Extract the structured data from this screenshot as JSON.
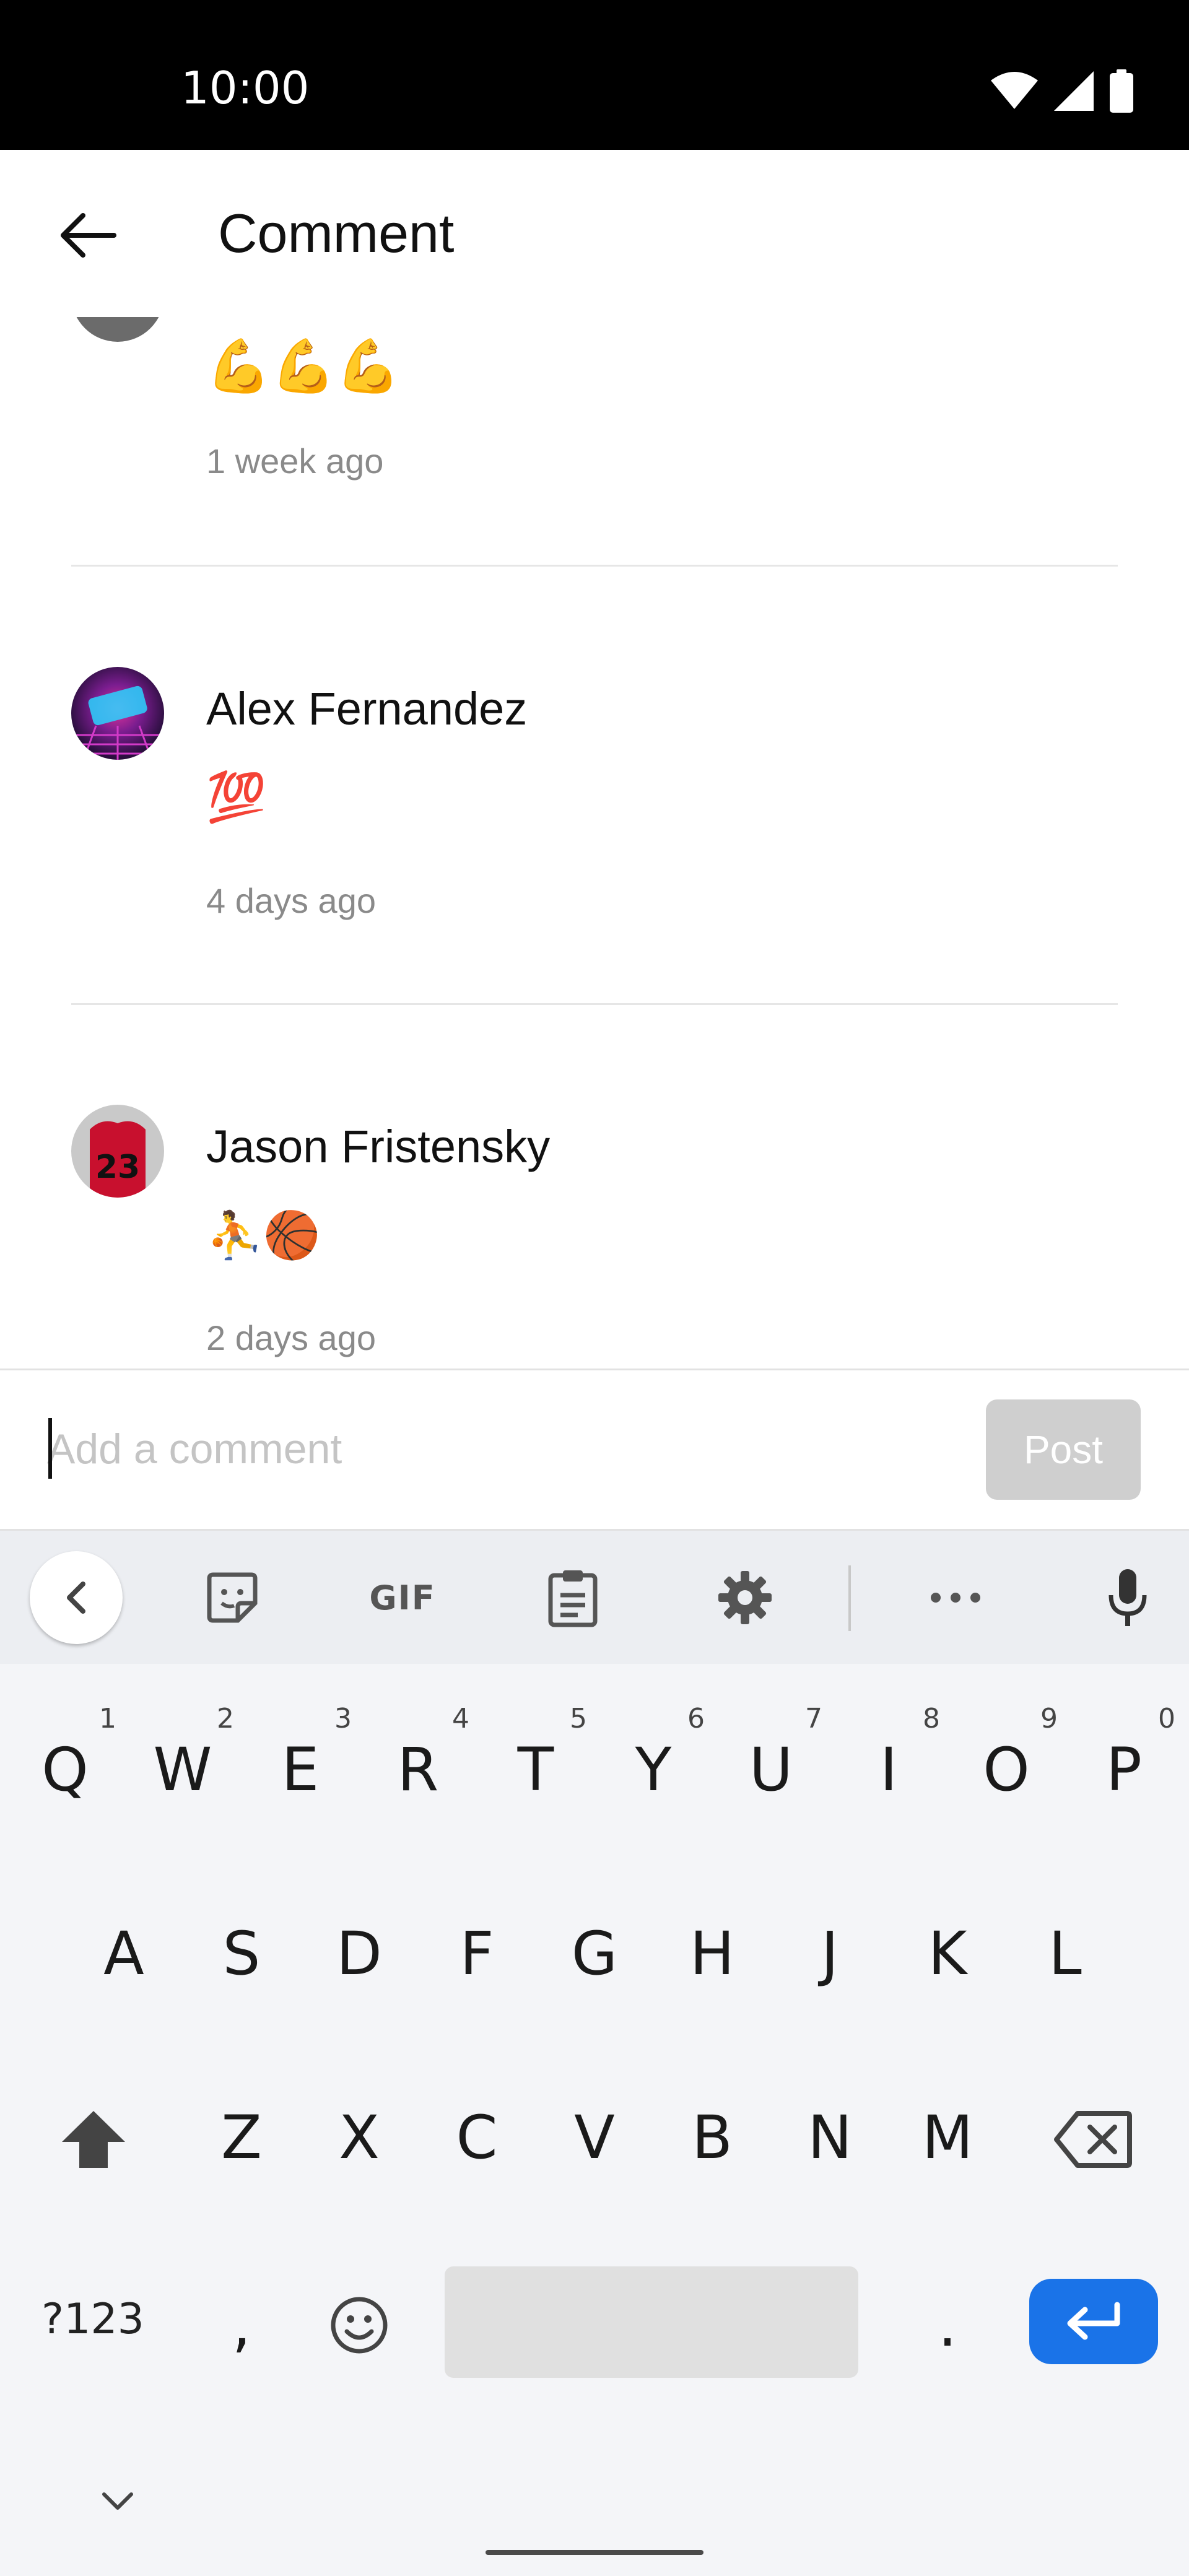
{
  "status_bar": {
    "time": "10:00",
    "icons": [
      "wifi-icon",
      "cellular-signal-icon",
      "battery-icon"
    ]
  },
  "app_bar": {
    "back_icon": "arrow-left-icon",
    "title": "Comment"
  },
  "comments": [
    {
      "name": "",
      "body": "💪💪💪",
      "time": "1 week ago"
    },
    {
      "name": "Alex Fernandez",
      "body": "💯",
      "time": "4 days ago"
    },
    {
      "name": "Jason Fristensky",
      "body": "⛹🏀",
      "time": "2 days ago"
    }
  ],
  "composer": {
    "placeholder": "Add a comment",
    "value": "",
    "post_label": "Post"
  },
  "keyboard": {
    "toolbar": {
      "gif_label": "GIF",
      "icons": [
        "chevron-left-icon",
        "sticker-icon",
        "gif-icon",
        "clipboard-icon",
        "settings-gear-icon",
        "more-icon",
        "microphone-icon"
      ]
    },
    "row1": {
      "keys": [
        "Q",
        "W",
        "E",
        "R",
        "T",
        "Y",
        "U",
        "I",
        "O",
        "P"
      ],
      "hints": [
        "1",
        "2",
        "3",
        "4",
        "5",
        "6",
        "7",
        "8",
        "9",
        "0"
      ]
    },
    "row2": {
      "keys": [
        "A",
        "S",
        "D",
        "F",
        "G",
        "H",
        "J",
        "K",
        "L"
      ]
    },
    "row3": {
      "keys": [
        "Z",
        "X",
        "C",
        "V",
        "B",
        "N",
        "M"
      ]
    },
    "bottom": {
      "symbols_label": "?123",
      "comma": ",",
      "period": "."
    }
  },
  "colors": {
    "accent": "#1a73e8",
    "post_disabled": "#cfcfcf",
    "timestamp": "#8a8a8a"
  }
}
